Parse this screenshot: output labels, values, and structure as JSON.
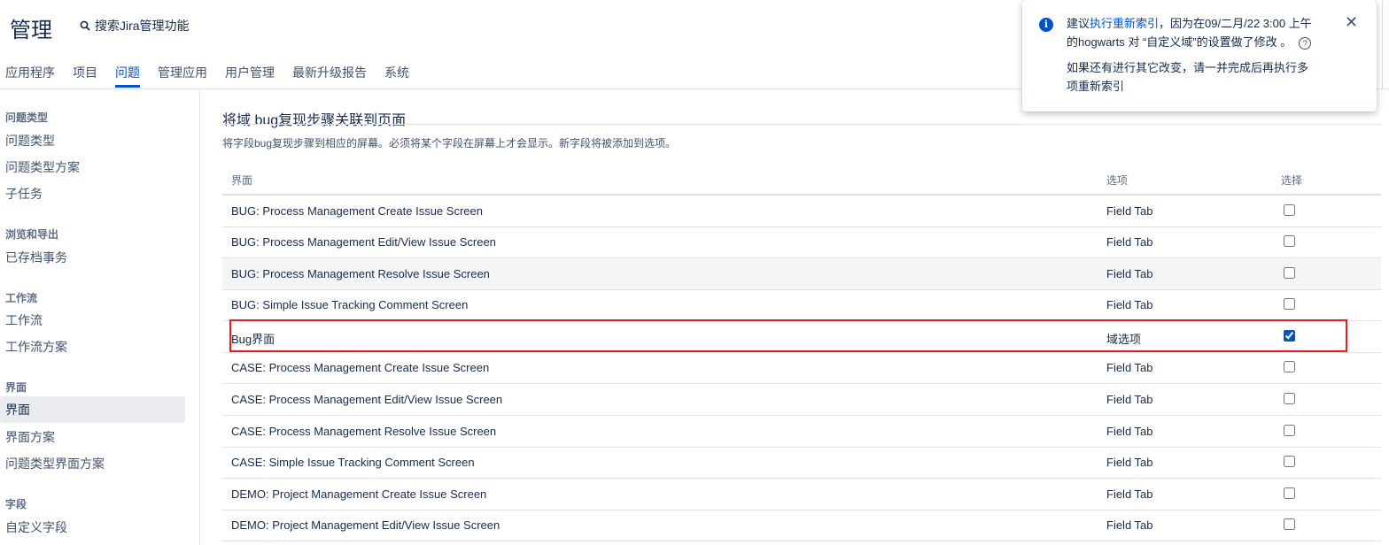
{
  "header": {
    "title": "管理",
    "search_label": "搜索Jira管理功能"
  },
  "tabs": [
    {
      "label": "应用程序"
    },
    {
      "label": "项目"
    },
    {
      "label": "问题"
    },
    {
      "label": "管理应用"
    },
    {
      "label": "用户管理"
    },
    {
      "label": "最新升级报告"
    },
    {
      "label": "系统"
    }
  ],
  "active_tab": "问题",
  "sidebar": {
    "sections": [
      {
        "heading": "问题类型",
        "items": [
          "问题类型",
          "问题类型方案",
          "子任务"
        ]
      },
      {
        "heading": "浏览和导出",
        "items": [
          "已存档事务"
        ]
      },
      {
        "heading": "工作流",
        "items": [
          "工作流",
          "工作流方案"
        ]
      },
      {
        "heading": "界面",
        "items": [
          "界面",
          "界面方案",
          "问题类型界面方案"
        ]
      },
      {
        "heading": "字段",
        "items": [
          "自定义字段"
        ]
      }
    ],
    "selected_item": "界面"
  },
  "main": {
    "title": "将域 bug复现步骤关联到页面",
    "description": "将字段bug复现步骤到相应的屏幕。必须将某个字段在屏幕上才会显示。新字段将被添加到选项。",
    "columns": [
      "界面",
      "选项",
      "选择"
    ],
    "rows": [
      {
        "screen": "BUG: Process Management Create Issue Screen",
        "tab": "Field Tab",
        "selected": false
      },
      {
        "screen": "BUG: Process Management Edit/View Issue Screen",
        "tab": "Field Tab",
        "selected": false
      },
      {
        "screen": "BUG: Process Management Resolve Issue Screen",
        "tab": "Field Tab",
        "selected": false
      },
      {
        "screen": "BUG: Simple Issue Tracking Comment Screen",
        "tab": "Field Tab",
        "selected": false
      },
      {
        "screen": "Bug界面",
        "tab": "域选项",
        "selected": true
      },
      {
        "screen": "CASE: Process Management Create Issue Screen",
        "tab": "Field Tab",
        "selected": false
      },
      {
        "screen": "CASE: Process Management Edit/View Issue Screen",
        "tab": "Field Tab",
        "selected": false
      },
      {
        "screen": "CASE: Process Management Resolve Issue Screen",
        "tab": "Field Tab",
        "selected": false
      },
      {
        "screen": "CASE: Simple Issue Tracking Comment Screen",
        "tab": "Field Tab",
        "selected": false
      },
      {
        "screen": "DEMO: Project Management Create Issue Screen",
        "tab": "Field Tab",
        "selected": false
      },
      {
        "screen": "DEMO: Project Management Edit/View Issue Screen",
        "tab": "Field Tab",
        "selected": false
      }
    ]
  },
  "flag": {
    "text_before_link": "建议",
    "link": "执行重新索引",
    "text_after_link": "，因为在09/二月/22 3:00 上午",
    "line2": "的hogwarts 对 “自定义域”的设置做了修改 。",
    "line3": "如果还有进行其它改变，请一并完成后再执行多",
    "line4": "项重新索引",
    "close_glyph": "✕",
    "help_glyph": "?"
  },
  "colors": {
    "accent": "#0052cc",
    "highlight_box": "#de1f26",
    "hover_row": "#f4f5f7"
  }
}
